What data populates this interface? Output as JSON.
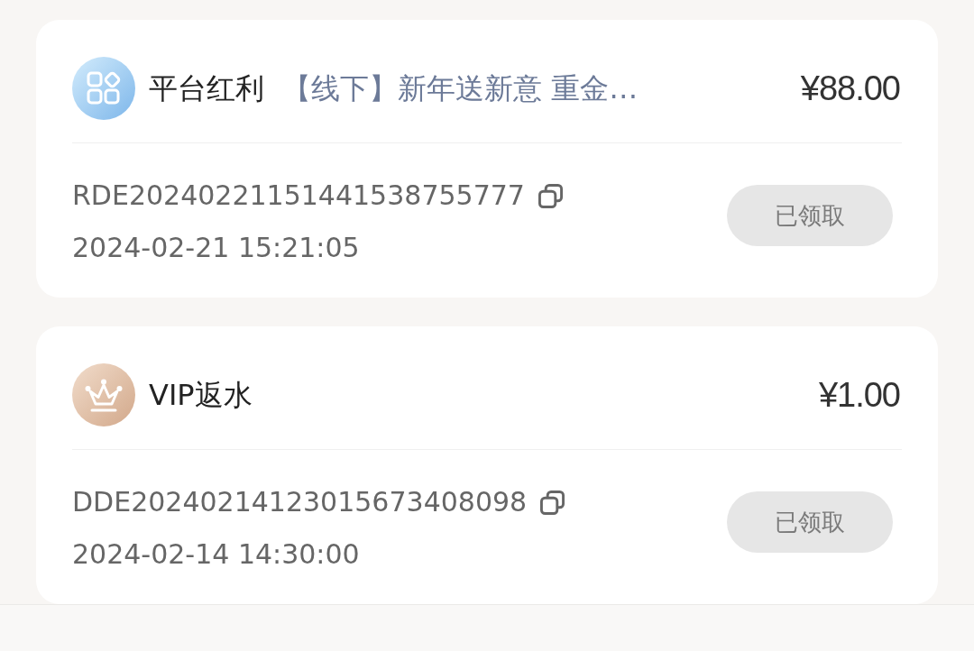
{
  "records": [
    {
      "kind": "bonus",
      "title": "平台红利",
      "subtitle": "【线下】新年送新意 重金…",
      "amount": "¥88.00",
      "order_no": "RDE20240221151441538755777",
      "time": "2024-02-21 15:21:05",
      "button": "已领取",
      "disabled": true
    },
    {
      "kind": "vip",
      "title": "VIP返水",
      "amount": "¥1.00",
      "order_no": "DDE20240214123015673408098",
      "time": "2024-02-14 14:30:00",
      "button": "已领取",
      "disabled": true
    }
  ]
}
